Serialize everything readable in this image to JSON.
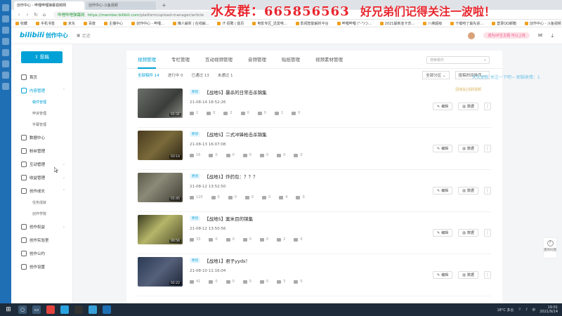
{
  "browser": {
    "tabs": [
      {
        "label": "创作中心 - 哔哩哔哩弹幕视频网",
        "active": true
      },
      {
        "label": "创作中心-斗鱼视频",
        "active": false
      }
    ],
    "new_tab": "+",
    "url": {
      "secure_label": "哔哩哔哩弹幕网",
      "domain": "https://member.bilibili.com",
      "path": "/platform/upload-manager/article"
    },
    "bookmarks": [
      "收藏",
      "手机书签",
      "京东",
      "百度",
      "主播中心",
      "创作中心 - 哔哩...",
      "懒人解析 | 在线解...",
      "iT 招聘 | 首页",
      "电影专区_迅雷电...",
      "影视智能解析平台",
      "哔哩哔哩 (°-°)つ...",
      "2021最新亚卡苏...",
      "八维超级",
      "下载吧了最先进...",
      "登录QQ邮箱",
      "创作中心 - 斗鱼视频"
    ]
  },
  "overlay": {
    "left": "水友群：665856563",
    "right": "好兄弟们记得关注一波啦！"
  },
  "header": {
    "logo_mark": "bilibili",
    "logo_text": "创作中心",
    "bell_label": "足迹",
    "pill": "成为UP主主题 可以上线",
    "icons": [
      "mail-icon",
      "download-icon"
    ]
  },
  "sidebar": {
    "upload_label": "投稿",
    "items": [
      {
        "label": "首页",
        "active": false
      },
      {
        "label": "内容管理",
        "active": true,
        "chev": "⌃"
      },
      {
        "label": "稿件管理",
        "sub": true,
        "active": true
      },
      {
        "label": "申诉管理",
        "sub": true
      },
      {
        "label": "字幕管理",
        "sub": true
      },
      {
        "label": "数据中心",
        "active": false
      },
      {
        "label": "粉丝管理",
        "active": false
      },
      {
        "label": "互动管理",
        "active": false,
        "chev": "⌄"
      },
      {
        "label": "收益管理",
        "active": false,
        "chev": "⌄"
      },
      {
        "label": "创作成长",
        "active": false,
        "chev": "⌃"
      },
      {
        "label": "任务成就",
        "sub": true
      },
      {
        "label": "创作学院",
        "sub": true
      },
      {
        "label": "创作权益",
        "active": false,
        "chev": "⌄"
      },
      {
        "label": "创作实验室",
        "active": false
      },
      {
        "label": "创作公约",
        "active": false
      },
      {
        "label": "创作设置",
        "active": false
      }
    ]
  },
  "main": {
    "tabs": [
      "视频管理",
      "专栏管理",
      "互动视频管理",
      "音频管理",
      "贴纸管理",
      "视频素材管理"
    ],
    "search_placeholder": "搜索稿件",
    "filters": [
      "全部稿件 14",
      "进行中 0",
      "已通过 13",
      "未通过 1"
    ],
    "zone_select": "全部分区 ⌄",
    "sort_select": "投稿时间排序 ⌄",
    "vis_note": "回收站|活跃视频",
    "float_note": "天天更新  关注一下吧~  刷锅表情：1",
    "edit_label": "编辑",
    "data_label": "数据",
    "more_label": "⋮",
    "videos": [
      {
        "badge": "原创",
        "title": "【战地5】暴杀的日常击杀锦集",
        "date": "21-08-14 18:52:26",
        "duration": "01:31",
        "stats": [
          "1",
          "0",
          "2",
          "0",
          "0",
          "1",
          "0"
        ]
      },
      {
        "badge": "原创",
        "title": "【战地5】二式冲锋枪击杀锦集",
        "date": "21-08-13 16:07:08",
        "duration": "03:14",
        "stats": [
          "16",
          "0",
          "0",
          "0",
          "0",
          "0",
          "0"
        ]
      },
      {
        "badge": "原创",
        "title": "【战地1】炸药包：？？？",
        "date": "21-08-12 13:52:50",
        "duration": "01:45",
        "stats": [
          "120",
          "0",
          "0",
          "0",
          "0",
          "4",
          "0"
        ]
      },
      {
        "badge": "原创",
        "title": "【战地5】案米目的锦集",
        "date": "21-08-12 13:50:56",
        "duration": "00:56",
        "stats": [
          "33",
          "0",
          "0",
          "0",
          "0",
          "2",
          "0"
        ]
      },
      {
        "badge": "原创",
        "title": "【战地1】君子yyds！",
        "date": "21-08-10 11:16:04",
        "duration": "02:22",
        "stats": [
          "41",
          "0",
          "0",
          "0",
          "0",
          "3",
          "0"
        ]
      }
    ]
  },
  "help": {
    "label": "遇到问题"
  },
  "taskbar": {
    "temp": "18°C 多云",
    "ime": "中",
    "time": "19:01",
    "date": "2021/9/14"
  }
}
